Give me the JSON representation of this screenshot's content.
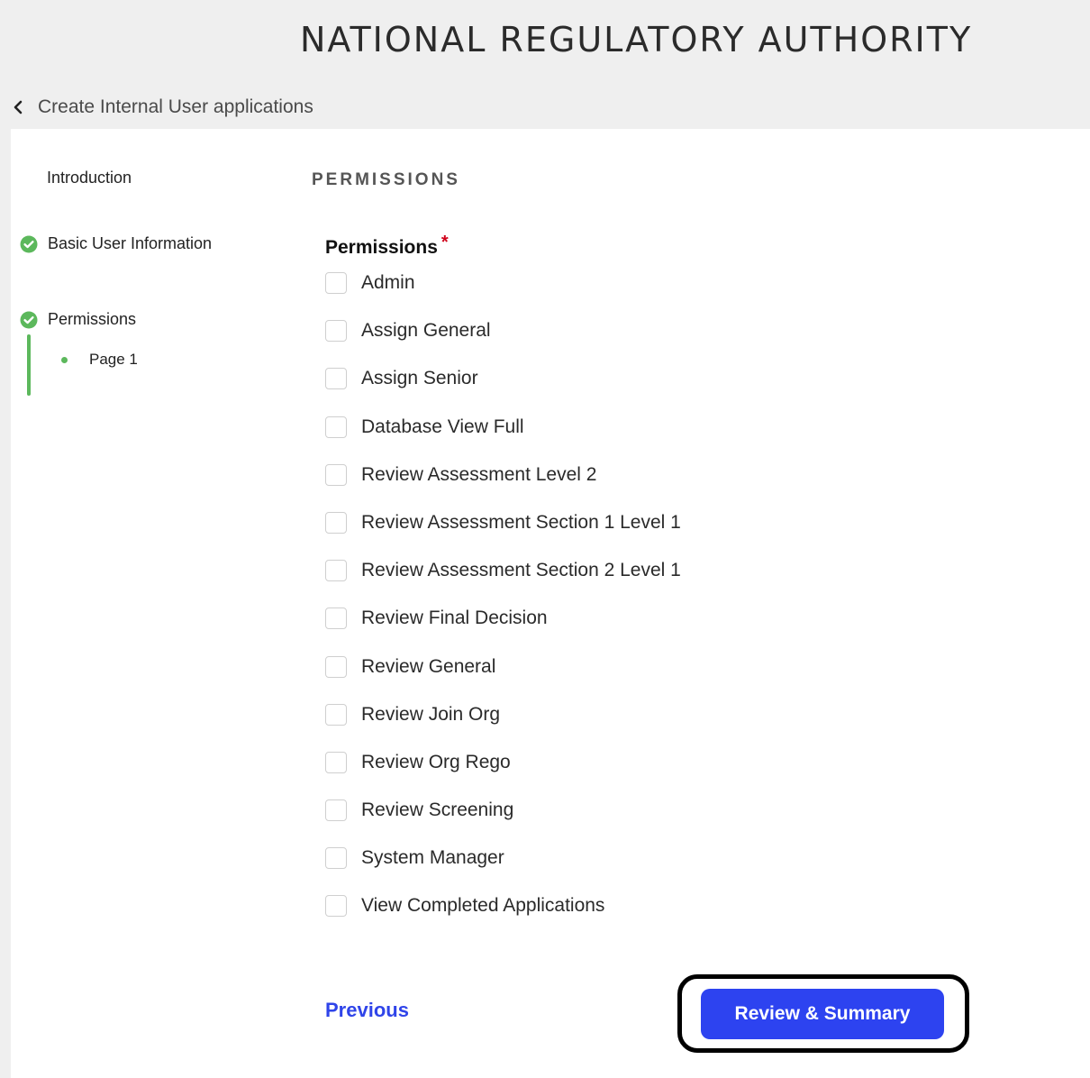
{
  "header": {
    "title": "NATIONAL REGULATORY AUTHORITY"
  },
  "breadcrumb": {
    "back_label": "Create Internal User applications",
    "icon": "chevron-left-icon"
  },
  "sidebar": {
    "items": [
      {
        "label": "Introduction",
        "completed": false
      },
      {
        "label": "Basic User Information",
        "completed": true,
        "icon": "check-circle-icon"
      },
      {
        "label": "Permissions",
        "completed": true,
        "icon": "check-circle-icon",
        "pages": [
          {
            "label": "Page 1",
            "current": true
          }
        ]
      }
    ],
    "accent_color": "#5cb85c"
  },
  "main": {
    "section_title": "PERMISSIONS",
    "field": {
      "label": "Permissions",
      "required_mark": "*",
      "options": [
        {
          "label": "Admin",
          "checked": false
        },
        {
          "label": "Assign General",
          "checked": false
        },
        {
          "label": "Assign Senior",
          "checked": false
        },
        {
          "label": "Database View Full",
          "checked": false
        },
        {
          "label": "Review Assessment Level 2",
          "checked": false
        },
        {
          "label": "Review Assessment Section 1 Level 1",
          "checked": false
        },
        {
          "label": "Review Assessment Section 2 Level 1",
          "checked": false
        },
        {
          "label": "Review Final Decision",
          "checked": false
        },
        {
          "label": "Review General",
          "checked": false
        },
        {
          "label": "Review Join Org",
          "checked": false
        },
        {
          "label": "Review Org Rego",
          "checked": false
        },
        {
          "label": "Review Screening",
          "checked": false
        },
        {
          "label": "System Manager",
          "checked": false
        },
        {
          "label": "View Completed Applications",
          "checked": false
        }
      ]
    }
  },
  "footer": {
    "previous_label": "Previous",
    "review_label": "Review & Summary",
    "primary_color": "#2d43f0"
  }
}
